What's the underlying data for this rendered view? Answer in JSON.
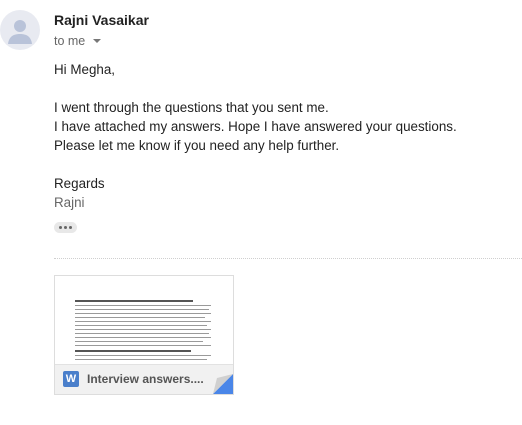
{
  "message": {
    "sender_name": "Rajni Vasaikar",
    "recipient_label": "to me",
    "greeting": "Hi Megha,",
    "body_lines": [
      "I went through the questions that you sent me.",
      "I have attached my answers. Hope I have answered your questions.",
      "Please let me know if you need any help further."
    ],
    "closing": "Regards",
    "signature": "Rajni"
  },
  "attachment": {
    "file_name": "Interview answers....",
    "file_type_letter": "W",
    "file_type": "Word document",
    "icon_color": "#4a7fcb"
  },
  "icons": {
    "avatar": "default-person-avatar",
    "recipient_dropdown": "caret-down",
    "show_trimmed": "ellipsis",
    "file_type": "word-doc"
  }
}
